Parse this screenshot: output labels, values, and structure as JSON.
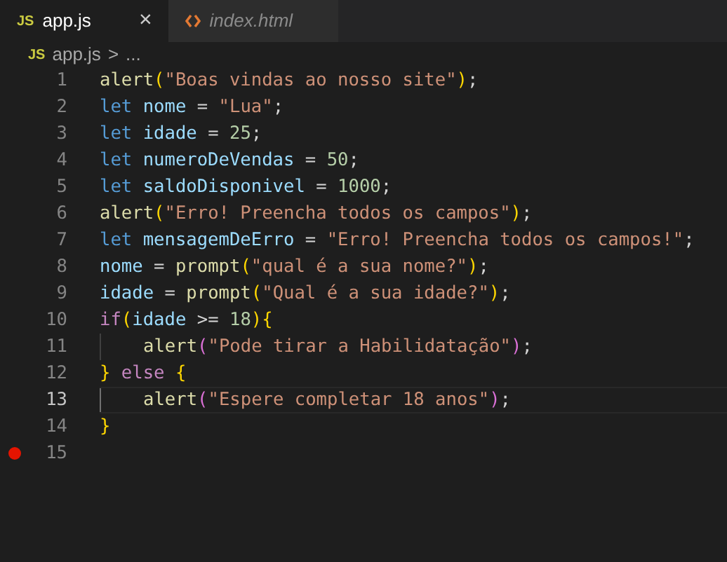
{
  "tabs": [
    {
      "icon": "JS",
      "label": "app.js",
      "selected": true,
      "close": "×",
      "kind": "js"
    },
    {
      "label": "index.html",
      "selected": false,
      "kind": "html"
    }
  ],
  "breadcrumb": {
    "icon": "JS",
    "file": "app.js",
    "separator": ">",
    "more": "..."
  },
  "lines": [
    {
      "number": "1",
      "current": false,
      "breakpoint": false,
      "guide": false,
      "tokens": [
        {
          "kind": "fn",
          "text": "alert"
        },
        {
          "kind": "b1",
          "text": "("
        },
        {
          "kind": "str",
          "text": "\"Boas vindas ao nosso site\""
        },
        {
          "kind": "b1",
          "text": ")"
        },
        {
          "kind": "p",
          "text": ";"
        }
      ]
    },
    {
      "number": "2",
      "current": false,
      "breakpoint": false,
      "guide": false,
      "tokens": [
        {
          "kind": "kw",
          "text": "let "
        },
        {
          "kind": "var",
          "text": "nome"
        },
        {
          "kind": "p",
          "text": " = "
        },
        {
          "kind": "str",
          "text": "\"Lua\""
        },
        {
          "kind": "p",
          "text": ";"
        }
      ]
    },
    {
      "number": "3",
      "current": false,
      "breakpoint": false,
      "guide": false,
      "tokens": [
        {
          "kind": "kw",
          "text": "let "
        },
        {
          "kind": "var",
          "text": "idade"
        },
        {
          "kind": "p",
          "text": " = "
        },
        {
          "kind": "num",
          "text": "25"
        },
        {
          "kind": "p",
          "text": ";"
        }
      ]
    },
    {
      "number": "4",
      "current": false,
      "breakpoint": false,
      "guide": false,
      "tokens": [
        {
          "kind": "kw",
          "text": "let "
        },
        {
          "kind": "var",
          "text": "numeroDeVendas"
        },
        {
          "kind": "p",
          "text": " = "
        },
        {
          "kind": "num",
          "text": "50"
        },
        {
          "kind": "p",
          "text": ";"
        }
      ]
    },
    {
      "number": "5",
      "current": false,
      "breakpoint": false,
      "guide": false,
      "tokens": [
        {
          "kind": "kw",
          "text": "let "
        },
        {
          "kind": "var",
          "text": "saldoDisponivel"
        },
        {
          "kind": "p",
          "text": " = "
        },
        {
          "kind": "num",
          "text": "1000"
        },
        {
          "kind": "p",
          "text": ";"
        }
      ]
    },
    {
      "number": "6",
      "current": false,
      "breakpoint": false,
      "guide": false,
      "tokens": [
        {
          "kind": "fn",
          "text": "alert"
        },
        {
          "kind": "b1",
          "text": "("
        },
        {
          "kind": "str",
          "text": "\"Erro! Preencha todos os campos\""
        },
        {
          "kind": "b1",
          "text": ")"
        },
        {
          "kind": "p",
          "text": ";"
        }
      ]
    },
    {
      "number": "7",
      "current": false,
      "breakpoint": false,
      "guide": false,
      "tokens": [
        {
          "kind": "kw",
          "text": "let "
        },
        {
          "kind": "var",
          "text": "mensagemDeErro"
        },
        {
          "kind": "p",
          "text": " = "
        },
        {
          "kind": "str",
          "text": "\"Erro! Preencha todos os campos!\""
        },
        {
          "kind": "p",
          "text": ";"
        }
      ]
    },
    {
      "number": "8",
      "current": false,
      "breakpoint": false,
      "guide": false,
      "tokens": [
        {
          "kind": "var",
          "text": "nome"
        },
        {
          "kind": "p",
          "text": " = "
        },
        {
          "kind": "fn",
          "text": "prompt"
        },
        {
          "kind": "b1",
          "text": "("
        },
        {
          "kind": "str",
          "text": "\"qual é a sua nome?\""
        },
        {
          "kind": "b1",
          "text": ")"
        },
        {
          "kind": "p",
          "text": ";"
        }
      ]
    },
    {
      "number": "9",
      "current": false,
      "breakpoint": false,
      "guide": false,
      "tokens": [
        {
          "kind": "var",
          "text": "idade"
        },
        {
          "kind": "p",
          "text": " = "
        },
        {
          "kind": "fn",
          "text": "prompt"
        },
        {
          "kind": "b1",
          "text": "("
        },
        {
          "kind": "str",
          "text": "\"Qual é a sua idade?\""
        },
        {
          "kind": "b1",
          "text": ")"
        },
        {
          "kind": "p",
          "text": ";"
        }
      ]
    },
    {
      "number": "10",
      "current": false,
      "breakpoint": false,
      "guide": false,
      "tokens": [
        {
          "kind": "ctl",
          "text": "if"
        },
        {
          "kind": "b1",
          "text": "("
        },
        {
          "kind": "var",
          "text": "idade"
        },
        {
          "kind": "p",
          "text": " >= "
        },
        {
          "kind": "num",
          "text": "18"
        },
        {
          "kind": "b1",
          "text": ")"
        },
        {
          "kind": "b1",
          "text": "{"
        }
      ]
    },
    {
      "number": "11",
      "current": false,
      "breakpoint": false,
      "guide": true,
      "tokens": [
        {
          "kind": "fn",
          "text": "alert"
        },
        {
          "kind": "b2",
          "text": "("
        },
        {
          "kind": "str",
          "text": "\"Pode tirar a Habilidatação\""
        },
        {
          "kind": "b2",
          "text": ")"
        },
        {
          "kind": "p",
          "text": ";"
        }
      ]
    },
    {
      "number": "12",
      "current": false,
      "breakpoint": false,
      "guide": false,
      "tokens": [
        {
          "kind": "b1",
          "text": "}"
        },
        {
          "kind": "ctl",
          "text": " else "
        },
        {
          "kind": "b1",
          "text": "{"
        }
      ]
    },
    {
      "number": "13",
      "current": true,
      "breakpoint": false,
      "guide": true,
      "tokens": [
        {
          "kind": "fn",
          "text": "alert"
        },
        {
          "kind": "b2",
          "text": "("
        },
        {
          "kind": "str",
          "text": "\"Espere completar 18 anos\""
        },
        {
          "kind": "b2",
          "text": ")"
        },
        {
          "kind": "p",
          "text": ";"
        }
      ]
    },
    {
      "number": "14",
      "current": false,
      "breakpoint": false,
      "guide": false,
      "tokens": [
        {
          "kind": "b1",
          "text": "}"
        }
      ]
    },
    {
      "number": "15",
      "current": false,
      "breakpoint": true,
      "guide": false
    }
  ]
}
